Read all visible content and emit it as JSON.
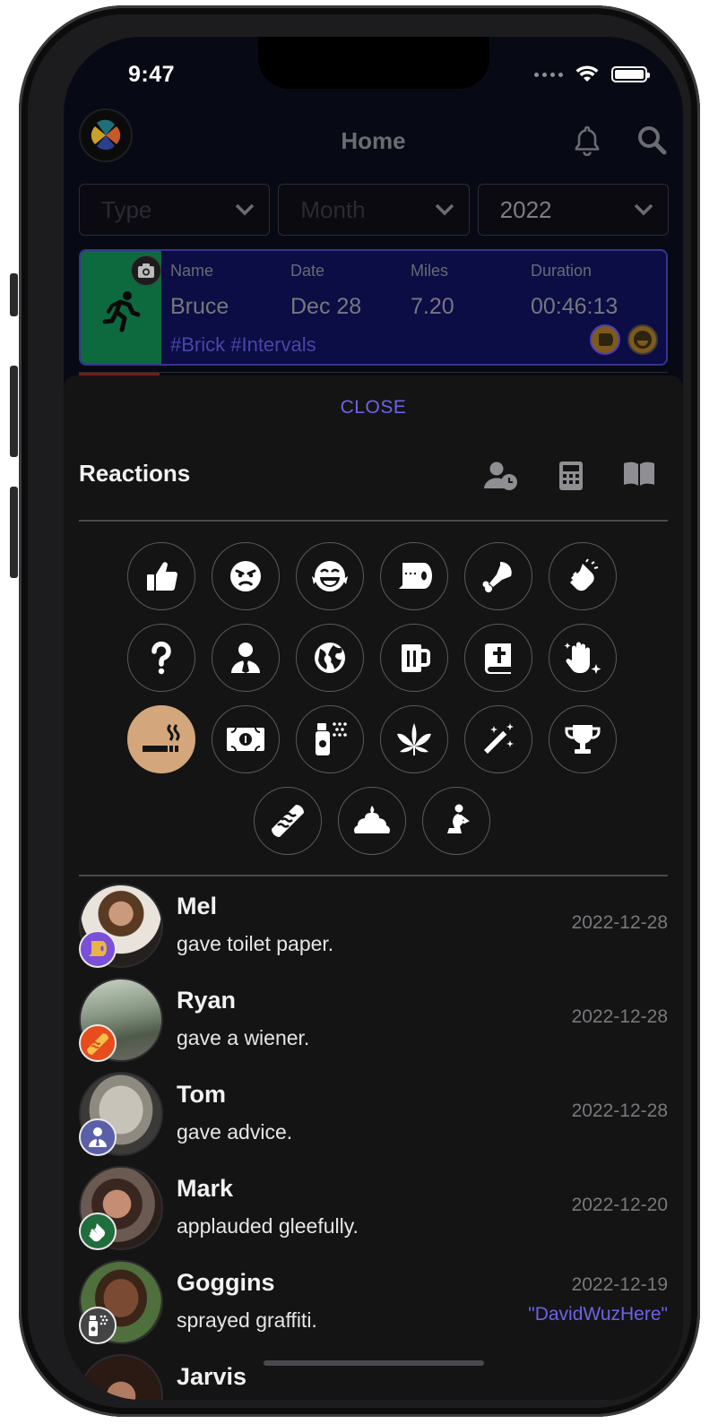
{
  "status_bar": {
    "time": "9:47"
  },
  "header": {
    "title": "Home"
  },
  "filters": {
    "type": "Type",
    "month": "Month",
    "year": "2022"
  },
  "activity_card": {
    "labels": {
      "name": "Name",
      "date": "Date",
      "miles": "Miles",
      "duration": "Duration"
    },
    "values": {
      "name": "Bruce",
      "date": "Dec 28",
      "miles": "7.20",
      "duration": "00:46:13"
    },
    "tags": "#Brick #Intervals",
    "accent_color": "#0d6a3f"
  },
  "sheet": {
    "close_label": "CLOSE",
    "title": "Reactions",
    "toolbar_icons": [
      "user-clock-icon",
      "calculator-icon",
      "book-open-icon"
    ],
    "reaction_icons": [
      "thumbs-up-icon",
      "angry-face-icon",
      "laughing-face-icon",
      "toilet-paper-icon",
      "drumstick-icon",
      "clapping-hands-icon",
      "question-mark-icon",
      "advisor-icon",
      "globe-icon",
      "beer-mug-icon",
      "bible-icon",
      "sparkle-hand-icon",
      "smoking-icon",
      "money-bill-icon",
      "spray-can-icon",
      "cannabis-leaf-icon",
      "magic-wand-icon",
      "trophy-icon",
      "hotdog-icon",
      "poop-icon",
      "praying-icon"
    ],
    "selected_reaction": "smoking-icon",
    "selected_color": "#d3a77b"
  },
  "reactions": [
    {
      "name": "Mel",
      "action": "gave toilet paper.",
      "date": "2022-12-28",
      "note": "",
      "badge_color": "#7b4fd8",
      "badge_icon": "toilet-paper-icon"
    },
    {
      "name": "Ryan",
      "action": "gave a wiener.",
      "date": "2022-12-28",
      "note": "",
      "badge_color": "#e74c1c",
      "badge_icon": "hotdog-icon"
    },
    {
      "name": "Tom",
      "action": "gave advice.",
      "date": "2022-12-28",
      "note": "",
      "badge_color": "#5a5fa8",
      "badge_icon": "advisor-icon"
    },
    {
      "name": "Mark",
      "action": "applauded gleefully.",
      "date": "2022-12-20",
      "note": "",
      "badge_color": "#1f6e3c",
      "badge_icon": "clapping-hands-icon"
    },
    {
      "name": "Goggins",
      "action": "sprayed graffiti.",
      "date": "2022-12-19",
      "note": "\"DavidWuzHere\"",
      "badge_color": "#444446",
      "badge_icon": "spray-can-icon"
    },
    {
      "name": "Jarvis",
      "action": "",
      "date": "",
      "note": ""
    }
  ]
}
